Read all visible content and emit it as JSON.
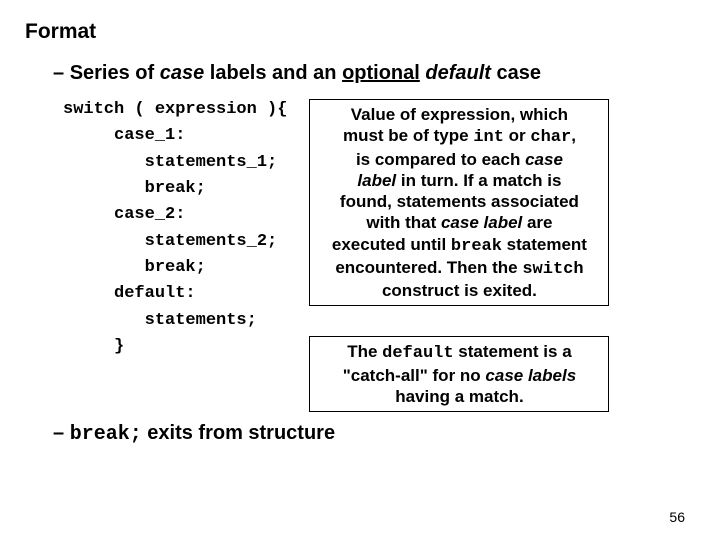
{
  "heading": "Format",
  "bullet1": {
    "dash": "–",
    "text_pre": "Series of ",
    "case": "case",
    "text_mid": " labels and an ",
    "optional": "optional",
    "space": " ",
    "default": "default",
    "text_post": " case"
  },
  "code": "switch ( expression ){\n     case_1:\n        statements_1;\n        break;\n     case_2:\n        statements_2;\n        break;\n     default:\n        statements;\n     }",
  "box1": {
    "l1a": "Value of expression, which",
    "l2a": "must be of type ",
    "l2b": "int",
    "l2c": " or ",
    "l2d": "char",
    "l2e": ",",
    "l3a": "is compared to each ",
    "l3b": "case",
    "l4a": "label",
    "l4b": " in turn. If a match is",
    "l5": "found, statements associated",
    "l6a": "with that ",
    "l6b": "case label",
    "l6c": " are",
    "l7a": "executed until ",
    "l7b": "break",
    "l7c": " statement",
    "l8a": "encountered. Then the ",
    "l8b": "switch",
    "l9": "construct is exited."
  },
  "box2": {
    "l1a": "The ",
    "l1b": "default",
    "l1c": " statement is a",
    "l2a": "\"catch-all\" for no ",
    "l2b": "case labels",
    "l3": "having a match."
  },
  "bullet2": {
    "dash": "–",
    "space": " ",
    "break": "break;",
    "text": " exits from structure"
  },
  "page": "56"
}
